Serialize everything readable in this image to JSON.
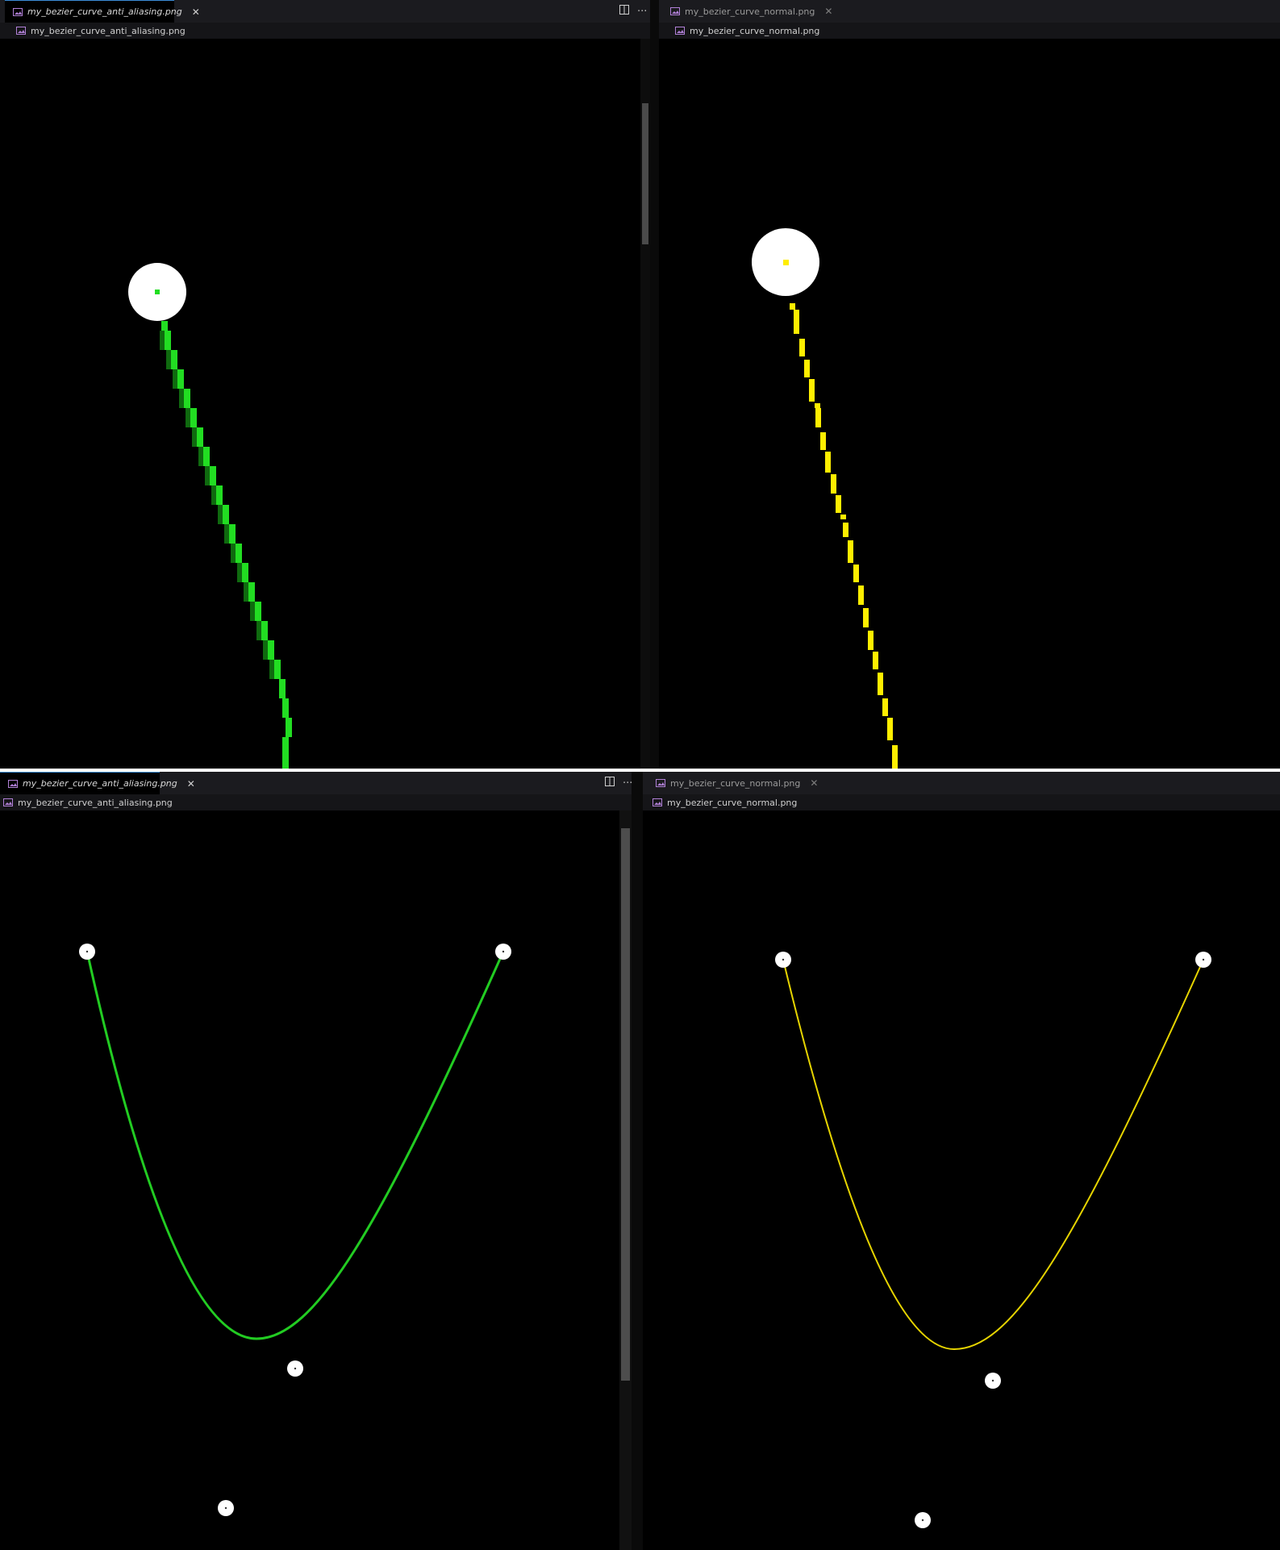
{
  "top_left": {
    "tab": {
      "label": "my_bezier_curve_anti_aliasing.png",
      "active": true,
      "close": "✕"
    },
    "breadcrumb": "my_bezier_curve_anti_aliasing.png",
    "actions": {
      "split": "split-editor-icon",
      "more": "···"
    },
    "curve_color": "#22dd22"
  },
  "top_right": {
    "tab": {
      "label": "my_bezier_curve_normal.png",
      "active": false,
      "close": "✕"
    },
    "breadcrumb": "my_bezier_curve_normal.png",
    "curve_color": "#ffee00"
  },
  "bottom_left": {
    "tab": {
      "label": "my_bezier_curve_anti_aliasing.png",
      "active": true,
      "close": "✕"
    },
    "breadcrumb": "my_bezier_curve_anti_aliasing.png",
    "actions": {
      "split": "split-editor-icon",
      "more": "···"
    },
    "curve_color": "#22cc22"
  },
  "bottom_right": {
    "tab": {
      "label": "my_bezier_curve_normal.png",
      "active": false,
      "close": "✕"
    },
    "breadcrumb": "my_bezier_curve_normal.png",
    "curve_color": "#e6d400"
  }
}
